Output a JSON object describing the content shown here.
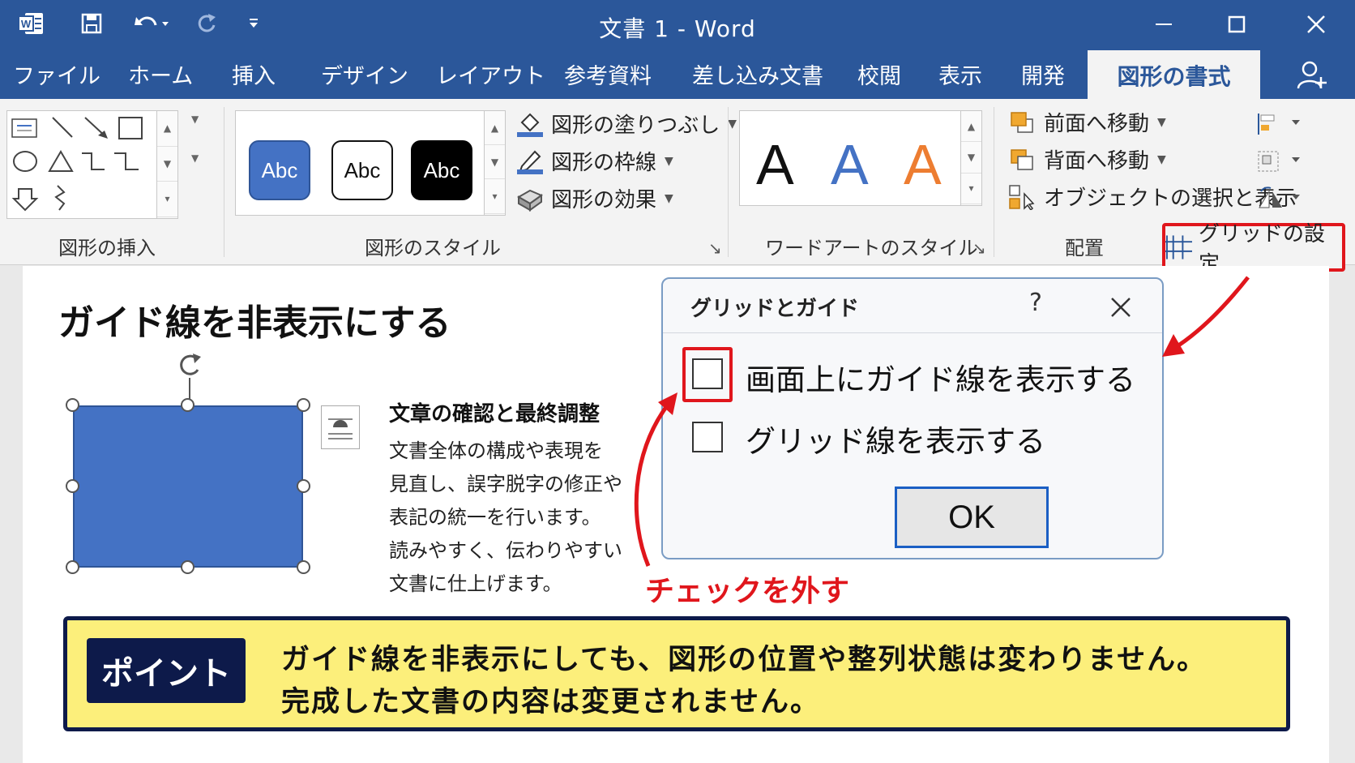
{
  "window": {
    "title": "文書 1  -  Word",
    "quick_access": [
      "word-logo-icon",
      "save-icon",
      "undo-icon",
      "redo-icon",
      "customize-icon"
    ],
    "controls": [
      "minimize-icon",
      "maximize-icon",
      "close-icon"
    ]
  },
  "tabs": [
    "ファイル",
    "ホーム",
    "挿入",
    "デザイン",
    "レイアウト",
    "参考資料",
    "差し込み文書",
    "校閲",
    "表示",
    "開発"
  ],
  "active_tab": "図形の書式",
  "ribbon": {
    "insert_shapes": {
      "label": "図形の挿入"
    },
    "shape_styles": {
      "label": "図形のスタイル",
      "samples": [
        "Abc",
        "Abc",
        "Abc"
      ],
      "fill": "図形の塗りつぶし",
      "outline": "図形の枠線",
      "effects": "図形の効果"
    },
    "wordart": {
      "label": "ワードアートのスタイル",
      "samples": [
        "A",
        "A",
        "A"
      ]
    },
    "arrange": {
      "label": "配置",
      "bring_forward": "前面へ移動",
      "send_backward": "背面へ移動",
      "selection_pane": "オブジェクトの選択と表示",
      "grid_settings": "グリッドの設定"
    }
  },
  "document": {
    "heading": "ガイド線を非表示にする",
    "para_title": "文章の確認と最終調整",
    "para_lines": [
      "文書全体の構成や表現を",
      "見直し、誤字脱字の修正や",
      "表記の統一を行います。",
      "読みやすく、伝わりやすい",
      "文書に仕上げます。"
    ]
  },
  "dialog": {
    "title": "グリッドとガイド",
    "help": "?",
    "option_guides": "画面上にガイド線を表示する",
    "option_grid": "グリッド線を表示する",
    "ok": "OK"
  },
  "annotation": "チェックを外す",
  "point": {
    "badge": "ポイント",
    "line1": "ガイド線を非表示にしても、図形の位置や整列状態は変わりません。",
    "line2": "完成した文書の内容は変更されません。"
  },
  "colors": {
    "title_bar": "#2b579a",
    "accent_red": "#e0161c",
    "shape_fill": "#4472c4",
    "point_bg": "#fcef7b",
    "point_badge": "#0d1a4a",
    "wordart_blue": "#4472c4",
    "wordart_orange": "#ed7d31"
  }
}
